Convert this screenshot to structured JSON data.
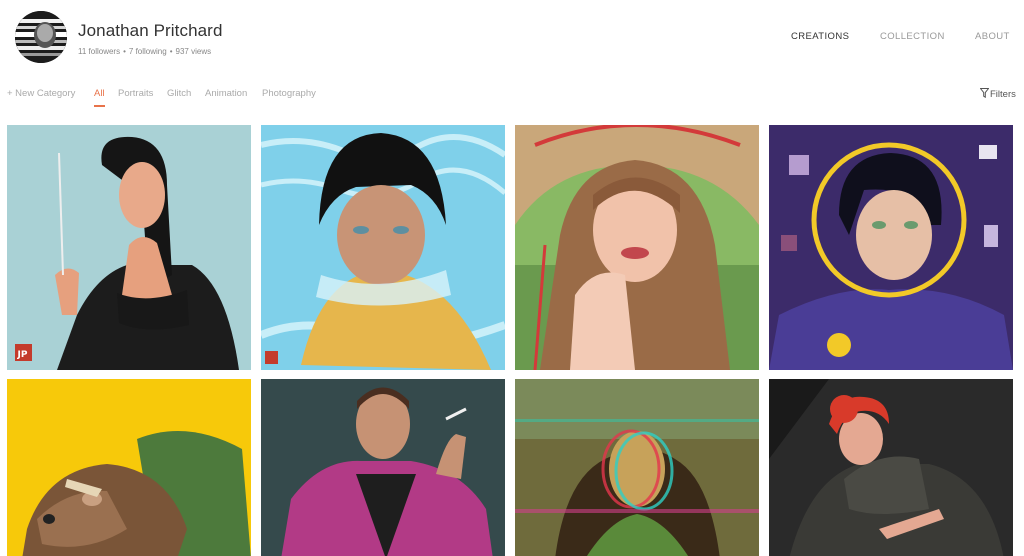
{
  "profile": {
    "name": "Jonathan Pritchard",
    "followers": "11 followers",
    "following": "7 following",
    "views": "937 views",
    "separator": "•"
  },
  "nav": {
    "creations": "CREATIONS",
    "collection": "COLLECTION",
    "about": "ABOUT"
  },
  "categories": {
    "new": "+ New Category",
    "all": "All",
    "portraits": "Portraits",
    "glitch": "Glitch",
    "animation": "Animation",
    "photography": "Photography",
    "filters": "Filters"
  },
  "colors": {
    "accent": "#e8734a",
    "active_nav": "#333333",
    "inactive": "#999999"
  },
  "gallery": [
    {
      "subject": "woman with cigarette on light blue background",
      "signature": "JP"
    },
    {
      "subject": "woman in swimming pool water",
      "signature": "JP"
    },
    {
      "subject": "woman in straw hat"
    },
    {
      "subject": "woman in space helmet"
    },
    {
      "subject": "rat with cigarette on yellow background"
    },
    {
      "subject": "man in pink robe holding cigarette"
    },
    {
      "subject": "glitched Mona Lisa"
    },
    {
      "subject": "red-haired woman in dark coat"
    }
  ]
}
